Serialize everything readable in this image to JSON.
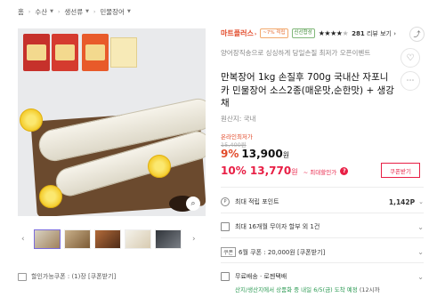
{
  "breadcrumb": {
    "home": "홈",
    "items": [
      "수산",
      "생선류",
      "민물장어"
    ]
  },
  "gallery": {
    "pack_text": "장어",
    "thumbs_count": 5
  },
  "coupon_bar": {
    "text": "할인가능쿠폰 : (1)장 [쿠폰받기]"
  },
  "product": {
    "brand": "마트플러스",
    "badge_points": "~7% 적립",
    "badge_new": "신선합성",
    "rating": 4.5,
    "review_count": "281",
    "review_label": "리뷰 보기",
    "subtitle": "양어장직송으로 싱싱하게 당일손질 최저가 오픈이벤트",
    "title": "만복장어 1kg 손질후 700g 국내산 자포니카 민물장어 소스2종(매운맛,순한맛) + 생강채",
    "origin": "원산지: 국내",
    "online_lowest": "온라인최저가",
    "original_price": "15,400원",
    "discount_pct": "9%",
    "price": "13,900",
    "price_unit": "원",
    "coupon_pct": "10%",
    "coupon_price": "13,770",
    "coupon_unit": "원",
    "coupon_max": "~ 최대할인가",
    "coupon_button": "쿠폰받기"
  },
  "info_rows": {
    "points_label": "최대 적립 포인트",
    "points_value": "1,142P",
    "installment_label": "최대 16개월 무이자 할부 외 1건",
    "coupon_tag": "쿠폰",
    "coupon_label": "6월 쿠폰 : 20,000원 [쿠폰받기]",
    "shipping_label": "무료배송 · 로젠택배",
    "shipping_info_green": "산지/생산지에서 상품화 중 내일 6/5(금) 도착 예정",
    "shipping_info_gray": "(12시까"
  },
  "colors": {
    "brand": "#e24a2a",
    "price_red": "#e81f45",
    "green": "#2b9a53"
  }
}
